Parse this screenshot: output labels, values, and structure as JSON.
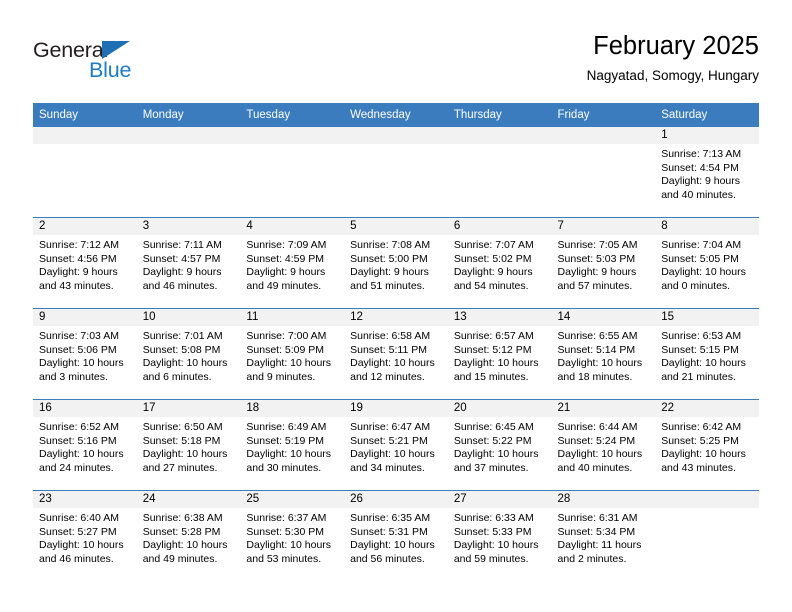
{
  "brand": {
    "name_dark": "General",
    "name_blue": "Blue",
    "accent_color": "#1f7bc4",
    "header_bg_color": "#3a7cbe"
  },
  "header": {
    "title": "February 2025",
    "subtitle": "Nagyatad, Somogy, Hungary"
  },
  "calendar": {
    "weekday_headers": [
      "Sunday",
      "Monday",
      "Tuesday",
      "Wednesday",
      "Thursday",
      "Friday",
      "Saturday"
    ],
    "weeks": [
      [
        {
          "day": "",
          "sunrise": "",
          "sunset": "",
          "daylight": "",
          "daylight2": ""
        },
        {
          "day": "",
          "sunrise": "",
          "sunset": "",
          "daylight": "",
          "daylight2": ""
        },
        {
          "day": "",
          "sunrise": "",
          "sunset": "",
          "daylight": "",
          "daylight2": ""
        },
        {
          "day": "",
          "sunrise": "",
          "sunset": "",
          "daylight": "",
          "daylight2": ""
        },
        {
          "day": "",
          "sunrise": "",
          "sunset": "",
          "daylight": "",
          "daylight2": ""
        },
        {
          "day": "",
          "sunrise": "",
          "sunset": "",
          "daylight": "",
          "daylight2": ""
        },
        {
          "day": "1",
          "sunrise": "Sunrise: 7:13 AM",
          "sunset": "Sunset: 4:54 PM",
          "daylight": "Daylight: 9 hours",
          "daylight2": "and 40 minutes."
        }
      ],
      [
        {
          "day": "2",
          "sunrise": "Sunrise: 7:12 AM",
          "sunset": "Sunset: 4:56 PM",
          "daylight": "Daylight: 9 hours",
          "daylight2": "and 43 minutes."
        },
        {
          "day": "3",
          "sunrise": "Sunrise: 7:11 AM",
          "sunset": "Sunset: 4:57 PM",
          "daylight": "Daylight: 9 hours",
          "daylight2": "and 46 minutes."
        },
        {
          "day": "4",
          "sunrise": "Sunrise: 7:09 AM",
          "sunset": "Sunset: 4:59 PM",
          "daylight": "Daylight: 9 hours",
          "daylight2": "and 49 minutes."
        },
        {
          "day": "5",
          "sunrise": "Sunrise: 7:08 AM",
          "sunset": "Sunset: 5:00 PM",
          "daylight": "Daylight: 9 hours",
          "daylight2": "and 51 minutes."
        },
        {
          "day": "6",
          "sunrise": "Sunrise: 7:07 AM",
          "sunset": "Sunset: 5:02 PM",
          "daylight": "Daylight: 9 hours",
          "daylight2": "and 54 minutes."
        },
        {
          "day": "7",
          "sunrise": "Sunrise: 7:05 AM",
          "sunset": "Sunset: 5:03 PM",
          "daylight": "Daylight: 9 hours",
          "daylight2": "and 57 minutes."
        },
        {
          "day": "8",
          "sunrise": "Sunrise: 7:04 AM",
          "sunset": "Sunset: 5:05 PM",
          "daylight": "Daylight: 10 hours",
          "daylight2": "and 0 minutes."
        }
      ],
      [
        {
          "day": "9",
          "sunrise": "Sunrise: 7:03 AM",
          "sunset": "Sunset: 5:06 PM",
          "daylight": "Daylight: 10 hours",
          "daylight2": "and 3 minutes."
        },
        {
          "day": "10",
          "sunrise": "Sunrise: 7:01 AM",
          "sunset": "Sunset: 5:08 PM",
          "daylight": "Daylight: 10 hours",
          "daylight2": "and 6 minutes."
        },
        {
          "day": "11",
          "sunrise": "Sunrise: 7:00 AM",
          "sunset": "Sunset: 5:09 PM",
          "daylight": "Daylight: 10 hours",
          "daylight2": "and 9 minutes."
        },
        {
          "day": "12",
          "sunrise": "Sunrise: 6:58 AM",
          "sunset": "Sunset: 5:11 PM",
          "daylight": "Daylight: 10 hours",
          "daylight2": "and 12 minutes."
        },
        {
          "day": "13",
          "sunrise": "Sunrise: 6:57 AM",
          "sunset": "Sunset: 5:12 PM",
          "daylight": "Daylight: 10 hours",
          "daylight2": "and 15 minutes."
        },
        {
          "day": "14",
          "sunrise": "Sunrise: 6:55 AM",
          "sunset": "Sunset: 5:14 PM",
          "daylight": "Daylight: 10 hours",
          "daylight2": "and 18 minutes."
        },
        {
          "day": "15",
          "sunrise": "Sunrise: 6:53 AM",
          "sunset": "Sunset: 5:15 PM",
          "daylight": "Daylight: 10 hours",
          "daylight2": "and 21 minutes."
        }
      ],
      [
        {
          "day": "16",
          "sunrise": "Sunrise: 6:52 AM",
          "sunset": "Sunset: 5:16 PM",
          "daylight": "Daylight: 10 hours",
          "daylight2": "and 24 minutes."
        },
        {
          "day": "17",
          "sunrise": "Sunrise: 6:50 AM",
          "sunset": "Sunset: 5:18 PM",
          "daylight": "Daylight: 10 hours",
          "daylight2": "and 27 minutes."
        },
        {
          "day": "18",
          "sunrise": "Sunrise: 6:49 AM",
          "sunset": "Sunset: 5:19 PM",
          "daylight": "Daylight: 10 hours",
          "daylight2": "and 30 minutes."
        },
        {
          "day": "19",
          "sunrise": "Sunrise: 6:47 AM",
          "sunset": "Sunset: 5:21 PM",
          "daylight": "Daylight: 10 hours",
          "daylight2": "and 34 minutes."
        },
        {
          "day": "20",
          "sunrise": "Sunrise: 6:45 AM",
          "sunset": "Sunset: 5:22 PM",
          "daylight": "Daylight: 10 hours",
          "daylight2": "and 37 minutes."
        },
        {
          "day": "21",
          "sunrise": "Sunrise: 6:44 AM",
          "sunset": "Sunset: 5:24 PM",
          "daylight": "Daylight: 10 hours",
          "daylight2": "and 40 minutes."
        },
        {
          "day": "22",
          "sunrise": "Sunrise: 6:42 AM",
          "sunset": "Sunset: 5:25 PM",
          "daylight": "Daylight: 10 hours",
          "daylight2": "and 43 minutes."
        }
      ],
      [
        {
          "day": "23",
          "sunrise": "Sunrise: 6:40 AM",
          "sunset": "Sunset: 5:27 PM",
          "daylight": "Daylight: 10 hours",
          "daylight2": "and 46 minutes."
        },
        {
          "day": "24",
          "sunrise": "Sunrise: 6:38 AM",
          "sunset": "Sunset: 5:28 PM",
          "daylight": "Daylight: 10 hours",
          "daylight2": "and 49 minutes."
        },
        {
          "day": "25",
          "sunrise": "Sunrise: 6:37 AM",
          "sunset": "Sunset: 5:30 PM",
          "daylight": "Daylight: 10 hours",
          "daylight2": "and 53 minutes."
        },
        {
          "day": "26",
          "sunrise": "Sunrise: 6:35 AM",
          "sunset": "Sunset: 5:31 PM",
          "daylight": "Daylight: 10 hours",
          "daylight2": "and 56 minutes."
        },
        {
          "day": "27",
          "sunrise": "Sunrise: 6:33 AM",
          "sunset": "Sunset: 5:33 PM",
          "daylight": "Daylight: 10 hours",
          "daylight2": "and 59 minutes."
        },
        {
          "day": "28",
          "sunrise": "Sunrise: 6:31 AM",
          "sunset": "Sunset: 5:34 PM",
          "daylight": "Daylight: 11 hours",
          "daylight2": "and 2 minutes."
        },
        {
          "day": "",
          "sunrise": "",
          "sunset": "",
          "daylight": "",
          "daylight2": ""
        }
      ]
    ]
  }
}
